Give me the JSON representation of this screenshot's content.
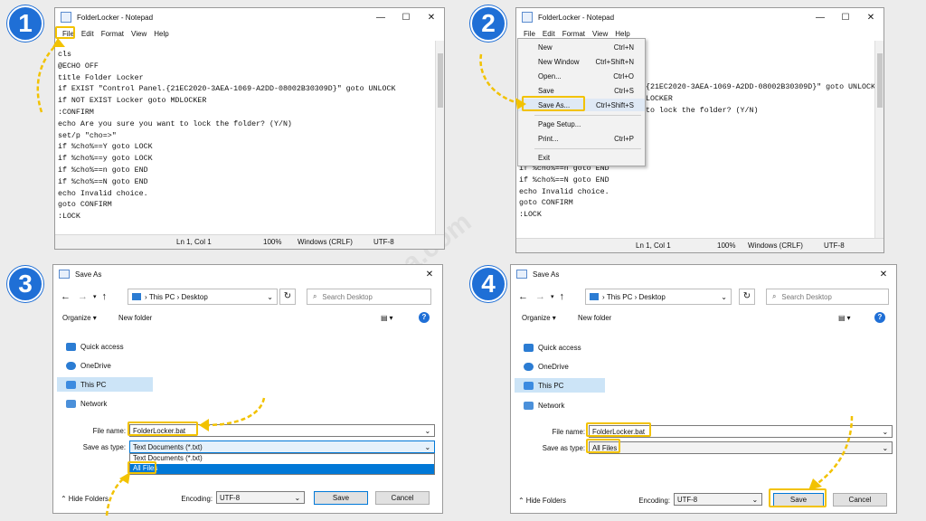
{
  "badges": [
    "1",
    "2",
    "3",
    "4"
  ],
  "watermark": "TechWafaha.com",
  "notepad": {
    "title": "FolderLocker - Notepad",
    "menu": [
      "File",
      "Edit",
      "Format",
      "View",
      "Help"
    ],
    "lines": [
      "cls",
      "@ECHO OFF",
      "title Folder Locker",
      "if EXIST \"Control Panel.{21EC2020-3AEA-1069-A2DD-08002B30309D}\" goto UNLOCK",
      "if NOT EXIST Locker goto MDLOCKER",
      ":CONFIRM",
      "echo Are you sure you want to lock the folder? (Y/N)",
      "set/p \"cho=>\"",
      "if %cho%==Y goto LOCK",
      "if %cho%==y goto LOCK",
      "if %cho%==n goto END",
      "if %cho%==N goto END",
      "echo Invalid choice.",
      "goto CONFIRM",
      ":LOCK"
    ],
    "lines2_visible": [
      "{21EC2020-3AEA-1069-A2DD-08002B30309D}\" goto UNLOCK",
      "LOCKER",
      "",
      "to lock the folder? (Y/N)"
    ],
    "lines2_tail": [
      "if %cho%==n goto END",
      "if %cho%==N goto END",
      "echo Invalid choice.",
      "goto CONFIRM",
      ":LOCK"
    ],
    "status": {
      "pos": "Ln 1, Col 1",
      "zoom": "100%",
      "eol": "Windows (CRLF)",
      "enc": "UTF-8"
    }
  },
  "file_menu": [
    {
      "label": "New",
      "acc": "Ctrl+N"
    },
    {
      "label": "New Window",
      "acc": "Ctrl+Shift+N"
    },
    {
      "label": "Open...",
      "acc": "Ctrl+O"
    },
    {
      "label": "Save",
      "acc": "Ctrl+S"
    },
    {
      "label": "Save As...",
      "acc": "Ctrl+Shift+S"
    },
    {
      "label": "Page Setup...",
      "acc": ""
    },
    {
      "label": "Print...",
      "acc": "Ctrl+P"
    },
    {
      "label": "Exit",
      "acc": ""
    }
  ],
  "save_dialog": {
    "title": "Save As",
    "path": [
      "This PC",
      "Desktop"
    ],
    "search_placeholder": "Search Desktop",
    "organize": "Organize",
    "new_folder": "New folder",
    "nav": [
      "Quick access",
      "OneDrive",
      "This PC",
      "Network"
    ],
    "file_name_label": "File name:",
    "file_name": "FolderLocker.bat",
    "type_label": "Save as type:",
    "type_value_3": "Text Documents (*.txt)",
    "type_options": [
      "Text Documents (*.txt)",
      "All Files"
    ],
    "type_value_4": "All Files",
    "hide_folders": "Hide Folders",
    "encoding_label": "Encoding:",
    "encoding": "UTF-8",
    "save": "Save",
    "cancel": "Cancel"
  },
  "colors": {
    "highlight": "#f2c200",
    "badge": "#1f6fd6",
    "selection": "#0078d7"
  }
}
